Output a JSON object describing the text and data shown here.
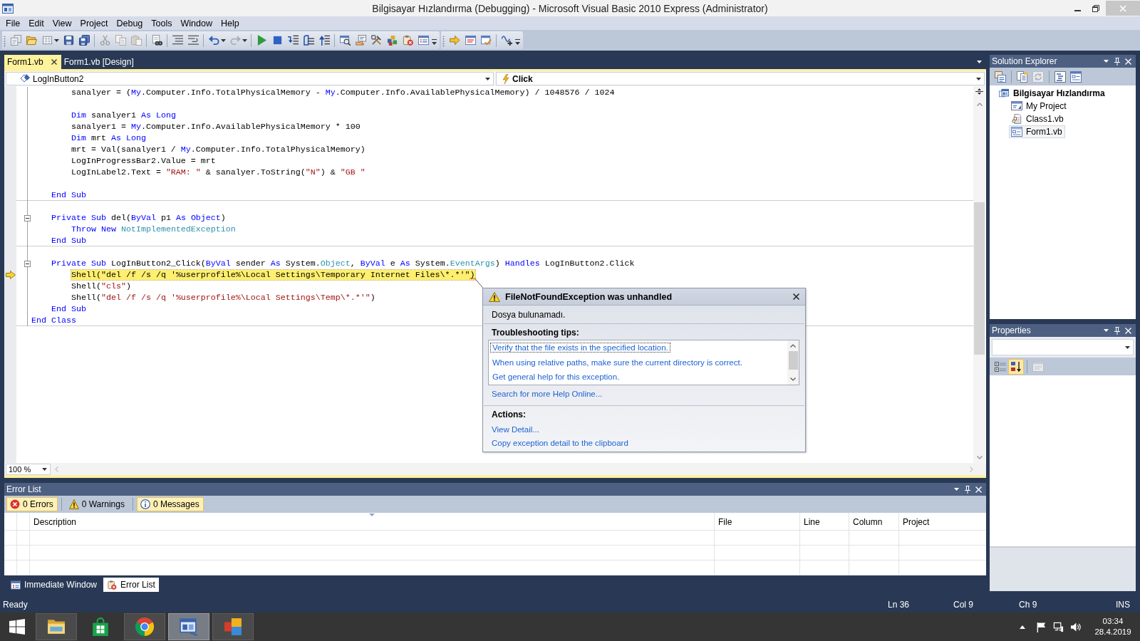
{
  "window": {
    "title": "Bilgisayar Hızlandırma (Debugging) - Microsoft Visual Basic 2010 Express (Administrator)"
  },
  "menu": [
    "File",
    "Edit",
    "View",
    "Project",
    "Debug",
    "Tools",
    "Window",
    "Help"
  ],
  "doc_tabs": [
    {
      "label": "Form1.vb",
      "selected": true
    },
    {
      "label": "Form1.vb [Design]",
      "selected": false
    }
  ],
  "navigation": {
    "object": "LogInButton2",
    "member": "Click"
  },
  "code": {
    "sections": [
      {
        "lines": [
          {
            "tokens": [
              {
                "kind": "plain",
                "text": "        sanalyer = ("
              },
              {
                "kind": "keyword",
                "text": "My"
              },
              {
                "kind": "plain",
                "text": ".Computer.Info.TotalPhysicalMemory - "
              },
              {
                "kind": "keyword",
                "text": "My"
              },
              {
                "kind": "plain",
                "text": ".Computer.Info.AvailablePhysicalMemory) / 1048576 / 1024"
              }
            ],
            "collapsible": false,
            "current": false
          },
          {
            "collapsible": false,
            "current": false
          },
          {
            "tokens": [
              {
                "kind": "keyword",
                "text": "        Dim"
              },
              {
                "kind": "plain",
                "text": " sanalyer1 "
              },
              {
                "kind": "keyword",
                "text": "As Long"
              }
            ],
            "collapsible": false,
            "current": false
          },
          {
            "tokens": [
              {
                "kind": "plain",
                "text": "        sanalyer1 = "
              },
              {
                "kind": "keyword",
                "text": "My"
              },
              {
                "kind": "plain",
                "text": ".Computer.Info.AvailablePhysicalMemory * 100"
              }
            ],
            "collapsible": false,
            "current": false
          },
          {
            "tokens": [
              {
                "kind": "keyword",
                "text": "        Dim"
              },
              {
                "kind": "plain",
                "text": " mrt "
              },
              {
                "kind": "keyword",
                "text": "As Long"
              }
            ],
            "collapsible": false,
            "current": false
          },
          {
            "tokens": [
              {
                "kind": "plain",
                "text": "        mrt = Val(sanalyer1 / "
              },
              {
                "kind": "keyword",
                "text": "My"
              },
              {
                "kind": "plain",
                "text": ".Computer.Info.TotalPhysicalMemory)"
              }
            ],
            "collapsible": false,
            "current": false
          },
          {
            "tokens": [
              {
                "kind": "plain",
                "text": "        LogInProgressBar2.Value = mrt"
              }
            ],
            "collapsible": false,
            "current": false
          },
          {
            "tokens": [
              {
                "kind": "plain",
                "text": "        LogInLabel2.Text = "
              },
              {
                "kind": "string",
                "text": "\"RAM: \""
              },
              {
                "kind": "plain",
                "text": " & sanalyer.ToString("
              },
              {
                "kind": "string",
                "text": "\"N\""
              },
              {
                "kind": "plain",
                "text": ") & "
              },
              {
                "kind": "string",
                "text": "\"GB \""
              }
            ],
            "collapsible": false,
            "current": false
          },
          {
            "collapsible": false,
            "current": false
          },
          {
            "tokens": [
              {
                "kind": "keyword",
                "text": "    End Sub"
              }
            ],
            "collapsible": false,
            "current": false
          }
        ]
      },
      {
        "lines": [
          {
            "collapsible": false,
            "current": false
          },
          {
            "tokens": [
              {
                "kind": "keyword",
                "text": "    Private Sub"
              },
              {
                "kind": "plain",
                "text": " del("
              },
              {
                "kind": "keyword",
                "text": "ByVal"
              },
              {
                "kind": "plain",
                "text": " p1 "
              },
              {
                "kind": "keyword",
                "text": "As Object"
              },
              {
                "kind": "plain",
                "text": ")"
              }
            ],
            "collapsible": true,
            "current": false
          },
          {
            "tokens": [
              {
                "kind": "keyword",
                "text": "        Throw New"
              },
              {
                "kind": "type",
                "text": " NotImplementedException"
              }
            ],
            "collapsible": false,
            "current": false
          },
          {
            "tokens": [
              {
                "kind": "keyword",
                "text": "    End Sub"
              }
            ],
            "collapsible": false,
            "current": false
          }
        ]
      },
      {
        "lines": [
          {
            "collapsible": false,
            "current": false
          },
          {
            "tokens": [
              {
                "kind": "keyword",
                "text": "    Private Sub"
              },
              {
                "kind": "plain",
                "text": " LogInButton2_Click("
              },
              {
                "kind": "keyword",
                "text": "ByVal"
              },
              {
                "kind": "plain",
                "text": " sender "
              },
              {
                "kind": "keyword",
                "text": "As"
              },
              {
                "kind": "plain",
                "text": " System."
              },
              {
                "kind": "type",
                "text": "Object"
              },
              {
                "kind": "plain",
                "text": ", "
              },
              {
                "kind": "keyword",
                "text": "ByVal"
              },
              {
                "kind": "plain",
                "text": " e "
              },
              {
                "kind": "keyword",
                "text": "As"
              },
              {
                "kind": "plain",
                "text": " System."
              },
              {
                "kind": "type",
                "text": "EventArgs"
              },
              {
                "kind": "plain",
                "text": ") "
              },
              {
                "kind": "keyword",
                "text": "Handles"
              },
              {
                "kind": "plain",
                "text": " LogInButton2.Click"
              }
            ],
            "collapsible": true,
            "current": false
          },
          {
            "tokens": [
              {
                "kind": "plain",
                "text": "        Shell("
              },
              {
                "kind": "string",
                "text": "\"del /f /s /q '%userprofile%\\Local Settings\\Temporary Internet Files\\*.*'\""
              },
              {
                "kind": "plain",
                "text": ")"
              }
            ],
            "collapsible": false,
            "current": true
          },
          {
            "tokens": [
              {
                "kind": "plain",
                "text": "        Shell("
              },
              {
                "kind": "string",
                "text": "\"cls\""
              },
              {
                "kind": "plain",
                "text": ")"
              }
            ],
            "collapsible": false,
            "current": false
          },
          {
            "tokens": [
              {
                "kind": "plain",
                "text": "        Shell("
              },
              {
                "kind": "string",
                "text": "\"del /f /s /q '%userprofile%\\Local Settings\\Temp\\*.*'\""
              },
              {
                "kind": "plain",
                "text": ")"
              }
            ],
            "collapsible": false,
            "current": false
          },
          {
            "tokens": [
              {
                "kind": "keyword",
                "text": "    End Sub"
              }
            ],
            "collapsible": false,
            "current": false
          },
          {
            "tokens": [
              {
                "kind": "keyword",
                "text": "End Class"
              }
            ],
            "collapsible": false,
            "current": false
          }
        ]
      }
    ]
  },
  "zoom": "100 %",
  "exception": {
    "title": "FileNotFoundException was unhandled",
    "message": "Dosya bulunamadı.",
    "tips_heading": "Troubleshooting tips:",
    "tips": [
      {
        "text": "Verify that the file exists in the specified location.",
        "selected": true
      },
      {
        "text": "When using relative paths, make sure the current directory is correct.",
        "selected": false
      },
      {
        "text": "Get general help for this exception.",
        "selected": false
      }
    ],
    "help_link": "Search for more Help Online...",
    "actions_heading": "Actions:",
    "actions": [
      "View Detail...",
      "Copy exception detail to the clipboard"
    ]
  },
  "solution_explorer": {
    "title": "Solution Explorer",
    "tree": [
      {
        "label": "Bilgisayar Hızlandırma",
        "kind": "project",
        "selected": false,
        "children": [
          {
            "label": "My Project",
            "kind": "settings",
            "selected": false
          },
          {
            "label": "Class1.vb",
            "kind": "class",
            "selected": false
          },
          {
            "label": "Form1.vb",
            "kind": "form",
            "selected": true
          }
        ]
      }
    ]
  },
  "properties": {
    "title": "Properties",
    "views": [
      {
        "kind": "categorized",
        "selected": false
      },
      {
        "kind": "alphabetical",
        "selected": true
      }
    ]
  },
  "error_list": {
    "title": "Error List",
    "filters": [
      {
        "kind": "error",
        "label": "0 Errors",
        "selected": true
      },
      {
        "kind": "warning",
        "label": "0 Warnings",
        "selected": false
      },
      {
        "kind": "message",
        "label": "0 Messages",
        "selected": true
      }
    ],
    "columns": [
      "Description",
      "File",
      "Line",
      "Column",
      "Project"
    ]
  },
  "bottom_tabs": [
    {
      "kind": "immediate",
      "label": "Immediate Window",
      "selected": false
    },
    {
      "kind": "errors",
      "label": "Error List",
      "selected": true
    }
  ],
  "status_bar": {
    "message": "Ready",
    "line": "Ln 36",
    "column": "Col 9",
    "char": "Ch 9",
    "mode": "INS"
  },
  "taskbar": {
    "apps": [
      {
        "kind": "folder",
        "running": true,
        "selected": false
      },
      {
        "kind": "bag",
        "running": false,
        "selected": false
      },
      {
        "kind": "ring",
        "running": true,
        "selected": false
      },
      {
        "kind": "vb-window",
        "running": true,
        "selected": true
      },
      {
        "kind": "tiles",
        "running": true,
        "selected": false
      }
    ],
    "time": "03:34",
    "date": "28.4.2019"
  }
}
